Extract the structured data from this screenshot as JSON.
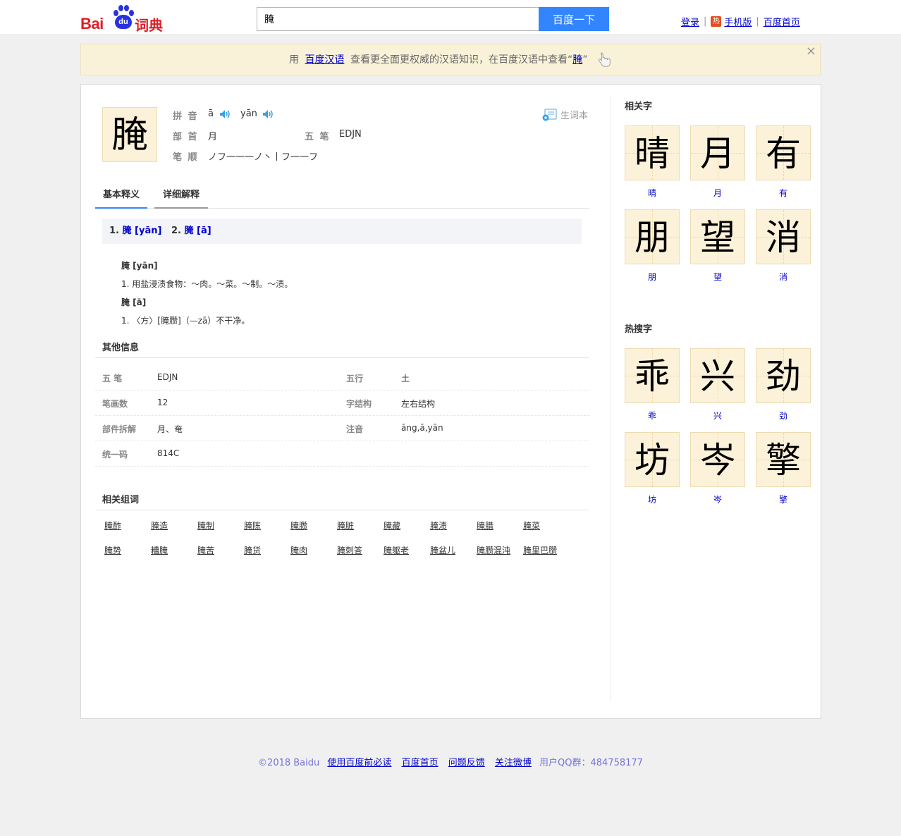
{
  "header": {
    "logo_bai": "Bai",
    "logo_du": "du",
    "logo_cidian": "词典",
    "search_value": "腌",
    "search_button": "百度一下",
    "links": {
      "login": "登录",
      "hot_badge": "热",
      "mobile": "手机版",
      "home": "百度首页"
    }
  },
  "notice": {
    "prefix": "用",
    "link": "百度汉语",
    "middle": "查看更全面更权威的汉语知识，在百度汉语中查看",
    "open_quote": "“",
    "char_link": "腌",
    "close_quote": "”",
    "close": "×"
  },
  "entry": {
    "char": "腌",
    "pinyin_label": "拼 音",
    "pinyin": [
      "ā",
      "yān"
    ],
    "radical_label": "部 首",
    "radical": "月",
    "wubi_label": "五 笔",
    "wubi": "EDJN",
    "strokes_label": "笔 顺",
    "strokes": "ノフ一一一ノ丶丨フ一一フ",
    "vocab_button": "生词本"
  },
  "tabs": {
    "basic": "基本释义",
    "detail": "详细解释"
  },
  "readings": [
    {
      "num": "1.",
      "text": "腌 [yān]"
    },
    {
      "num": "2.",
      "text": "腌 [ā]"
    }
  ],
  "definitions": [
    {
      "head": "腌 [yān]",
      "line": "1. 用盐浸渍食物：～肉。～菜。～制。～渍。"
    },
    {
      "head": "腌 [ā]",
      "line": "1. 〈方〉[腌臜]（—zā）不干净。"
    }
  ],
  "other_info": {
    "title": "其他信息",
    "rows": [
      {
        "l1": "五 笔",
        "v1": "EDJN",
        "l2": "五行",
        "v2": "土"
      },
      {
        "l1": "笔画数",
        "v1": "12",
        "l2": "字结构",
        "v2": "左右结构"
      },
      {
        "l1": "部件拆解",
        "v1": "月、奄",
        "l2": "注音",
        "v2": "āng,ā,yān"
      },
      {
        "l1": "统一码",
        "v1": "814C",
        "l2": "",
        "v2": ""
      }
    ]
  },
  "related_words": {
    "title": "相关组词",
    "row1": [
      "腌酢",
      "腌造",
      "腌制",
      "腌陈",
      "腌臜",
      "腌脏",
      "腌藏",
      "腌渍",
      "腌腊",
      "腌菜"
    ],
    "row2": [
      "腌势",
      "糟腌",
      "腌苦",
      "腌货",
      "腌肉",
      "腌刺答",
      "腌躯老",
      "腌盆儿",
      "腌臜混沌",
      "腌里巴臜"
    ]
  },
  "side": {
    "related_title": "相关字",
    "related": [
      "晴",
      "月",
      "有",
      "朋",
      "望",
      "消"
    ],
    "hot_title": "热搜字",
    "hot": [
      "乖",
      "兴",
      "劲",
      "坊",
      "岑",
      "擎"
    ]
  },
  "footer": {
    "copyright": "©2018 Baidu",
    "links": [
      "使用百度前必读",
      "百度首页",
      "问题反馈",
      "关注微博"
    ],
    "qq": "用户QQ群：484758177"
  }
}
